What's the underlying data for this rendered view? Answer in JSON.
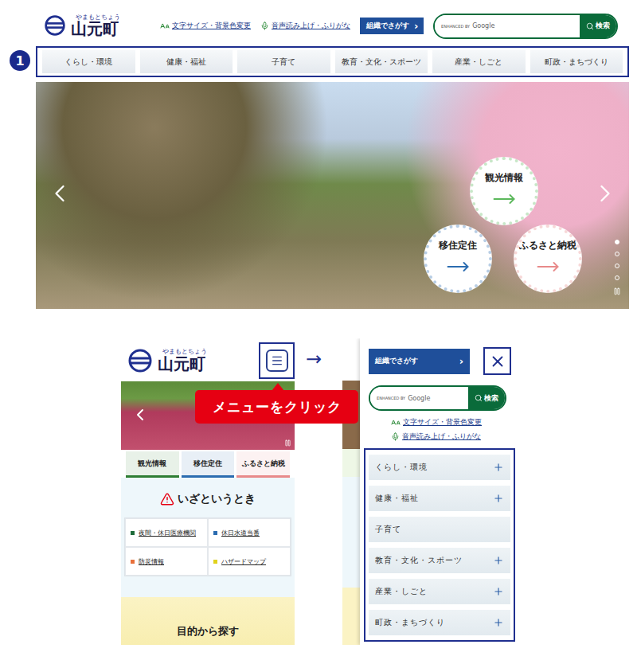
{
  "annotation": {
    "number": "1"
  },
  "desktop": {
    "logo": {
      "kana": "やまもとちょう",
      "name": "山元町"
    },
    "links": [
      {
        "label": "文字サイズ・背景色変更",
        "kind": "text-size"
      },
      {
        "label": "音声読み上げ・ふりがな",
        "kind": "voice"
      }
    ],
    "org_button": {
      "label": "組織でさがす",
      "chevron": "›"
    },
    "search": {
      "badge": "ENHANCED BY",
      "brand": "Google",
      "button": "検索"
    },
    "nav": [
      "くらし・環境",
      "健康・福祉",
      "子育て",
      "教育・文化・スポーツ",
      "産業・しごと",
      "町政・まちづくり"
    ],
    "hero": {
      "slides": [
        {
          "selected": true
        },
        {
          "selected": false
        },
        {
          "selected": false
        },
        {
          "selected": false
        }
      ],
      "bubbles": [
        {
          "label": "観光情報",
          "color": "#5cb85c"
        },
        {
          "label": "移住定住",
          "color": "#2b6cb0"
        },
        {
          "label": "ふるさと納税",
          "color": "#e88a8a"
        }
      ]
    }
  },
  "arrow": "→",
  "callout": "メニューをクリック",
  "mobile_home": {
    "logo": {
      "kana": "やまもとちょう",
      "name": "山元町"
    },
    "tabs": [
      {
        "label": "観光情報",
        "color": "#2e7d32"
      },
      {
        "label": "移住定住",
        "color": "#2b6cb0"
      },
      {
        "label": "ふるさと納税",
        "color": "#e88a8a"
      }
    ],
    "emergency": {
      "title": "いざというとき",
      "links": [
        {
          "label": "夜間・休日医療機関",
          "color": "#1e6b3a"
        },
        {
          "label": "休日水道当番",
          "color": "#2b6cb0"
        },
        {
          "label": "防災情報",
          "color": "#e8703a"
        },
        {
          "label": "ハザードマップ",
          "color": "#e0d21c"
        }
      ]
    },
    "section_title": "目的から探す"
  },
  "mobile_menu": {
    "org_button": {
      "label": "組織でさがす",
      "chevron": "›"
    },
    "search": {
      "badge": "ENHANCED BY",
      "brand": "Google",
      "button": "検索"
    },
    "links": [
      {
        "label": "文字サイズ・背景色変更",
        "kind": "text-size"
      },
      {
        "label": "音声読み上げ・ふりがな",
        "kind": "voice"
      }
    ],
    "menu": [
      {
        "label": "くらし・環境",
        "expandable": true
      },
      {
        "label": "健康・福祉",
        "expandable": true
      },
      {
        "label": "子育て",
        "expandable": false
      },
      {
        "label": "教育・文化・スポーツ",
        "expandable": true
      },
      {
        "label": "産業・しごと",
        "expandable": true
      },
      {
        "label": "町政・まちづくり",
        "expandable": true
      }
    ]
  }
}
